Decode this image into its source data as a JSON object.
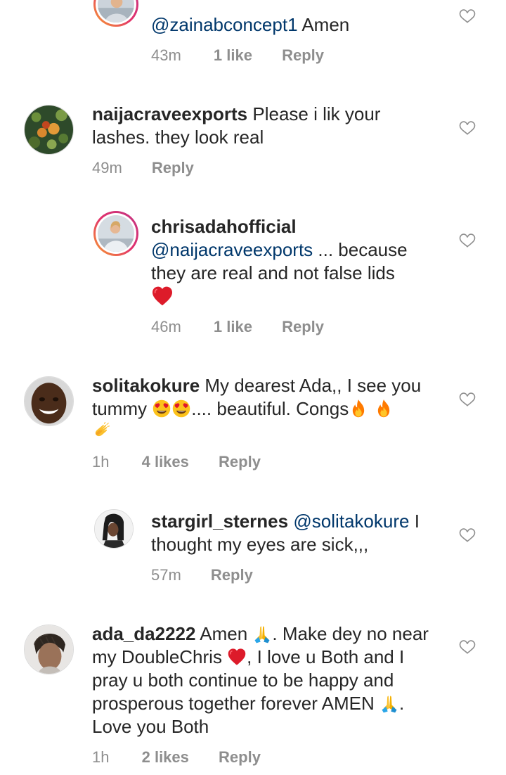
{
  "comments": [
    {
      "username": "",
      "mention": "@zainabconcept1",
      "text": " Amen",
      "time": "43m",
      "likes": "1 like",
      "reply": "Reply"
    },
    {
      "username": "naijacraveexports",
      "text": " Please i lik your lashes. they look real",
      "time": "49m",
      "reply": "Reply"
    },
    {
      "username": "chrisadahofficial",
      "mention": "@naijacraveexports",
      "text": " ... because they are real and not false lids",
      "emoji": "red-heart",
      "time": "46m",
      "likes": "1 like",
      "reply": "Reply"
    },
    {
      "username": "solitakokure",
      "text_part1": " My dearest Ada,, I see you tummy ",
      "text_part2": ".... beautiful.  Congs",
      "emojis": [
        "heart-eyes",
        "heart-eyes",
        "fire",
        "fire",
        "clapping-hands"
      ],
      "time": "1h",
      "likes": "4 likes",
      "reply": "Reply"
    },
    {
      "username": "stargirl_sternes",
      "mention": "@solitakokure",
      "text": " I thought my eyes are sick,,,",
      "time": "57m",
      "reply": "Reply"
    },
    {
      "username": "ada_da2222",
      "text_part1": " Amen ",
      "text_part2": ". Make dey no near my DoubleChris ",
      "text_part3": ", I love u Both and I pray u both continue to be happy and prosperous together forever AMEN ",
      "text_part4": ". Love you Both",
      "emojis": [
        "folded-hands",
        "red-heart",
        "folded-hands"
      ],
      "time": "1h",
      "likes": "2 likes",
      "reply": "Reply"
    }
  ],
  "colors": {
    "text": "#262626",
    "mention": "#00376b",
    "meta": "#8e8e8e",
    "heart_outline": "#8e8e8e",
    "emoji_heart": "#e0162b"
  }
}
